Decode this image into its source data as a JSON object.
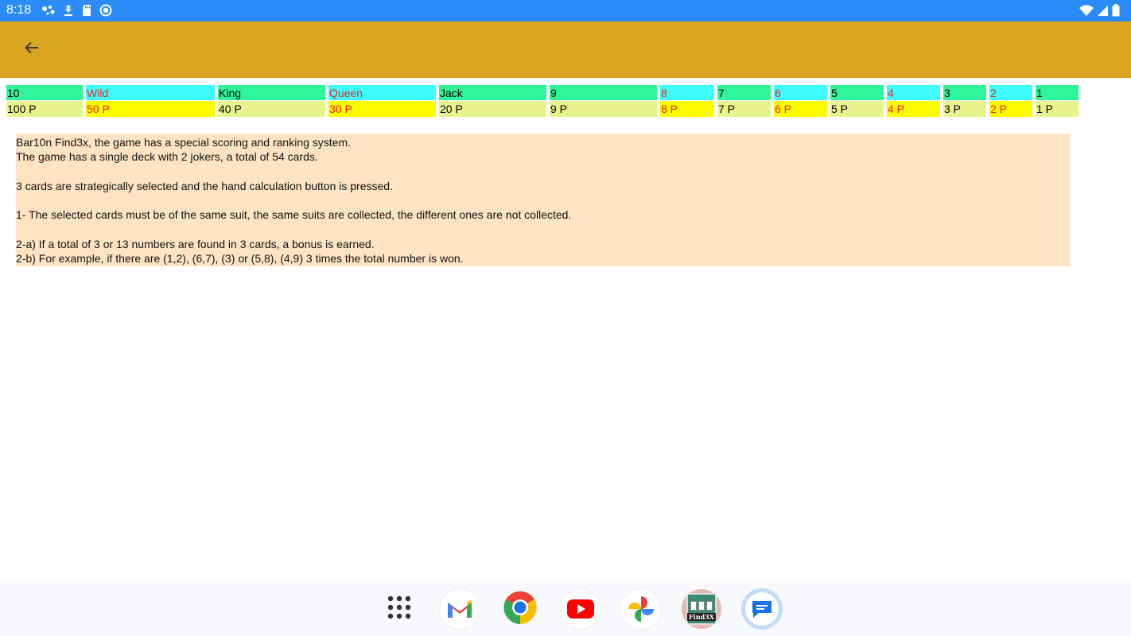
{
  "status_bar": {
    "time": "8:18",
    "left_icons": [
      "assistant-icon",
      "download-icon",
      "sd-card-icon",
      "sync-icon"
    ],
    "right_icons": [
      "wifi-icon",
      "signal-icon",
      "battery-icon"
    ]
  },
  "app_bar": {
    "back_icon": "arrow-left-icon",
    "color": "#daa520"
  },
  "score_table": {
    "columns": [
      {
        "name": "10",
        "points": "100 P",
        "style": "teal"
      },
      {
        "name": "Wild",
        "points": "50 P",
        "style": "cyan"
      },
      {
        "name": "King",
        "points": "40 P",
        "style": "teal"
      },
      {
        "name": "Queen",
        "points": "30 P",
        "style": "cyan"
      },
      {
        "name": "Jack",
        "points": "20 P",
        "style": "teal"
      },
      {
        "name": "9",
        "points": "9 P",
        "style": "teal"
      },
      {
        "name": "8",
        "points": "8 P",
        "style": "cyan"
      },
      {
        "name": "7",
        "points": "7 P",
        "style": "teal"
      },
      {
        "name": "6",
        "points": "6 P",
        "style": "cyan"
      },
      {
        "name": "5",
        "points": "5 P",
        "style": "teal"
      },
      {
        "name": "4",
        "points": "4 P",
        "style": "cyan"
      },
      {
        "name": "3",
        "points": "3 P",
        "style": "teal"
      },
      {
        "name": "2",
        "points": "2 P",
        "style": "cyan"
      },
      {
        "name": "1",
        "points": "1 P",
        "style": "teal"
      }
    ]
  },
  "description": {
    "lines": [
      "Bar10n Find3x, the game has a special scoring and ranking system.",
      "The game has a single deck with 2 jokers, a total of 54 cards.",
      "",
      "3 cards are strategically selected and the hand calculation button is pressed.",
      "",
      "1- The selected cards must be of the same suit, the same suits are collected, the different ones are not collected.",
      "",
      "2-a) If a total of 3 or 13 numbers are found in 3 cards, a bonus is earned.",
      "2-b) For example, if there are (1,2), (6,7), (3) or (5,8), (4,9) 3 times the total number is won."
    ]
  },
  "dock": {
    "apps": [
      "app-drawer-icon",
      "gmail-icon",
      "chrome-icon",
      "youtube-icon",
      "photos-icon",
      "find3x-app-icon",
      "messages-icon"
    ],
    "find3x_label": "Find3X"
  },
  "colors": {
    "status_bar": "#2b8cf8",
    "teal_cell": "#2ff59a",
    "cyan_cell": "#3ffcfc",
    "pale_cell": "#e8f58c",
    "yellow_cell": "#fcfc00",
    "description_bg": "#ffe4c4"
  }
}
